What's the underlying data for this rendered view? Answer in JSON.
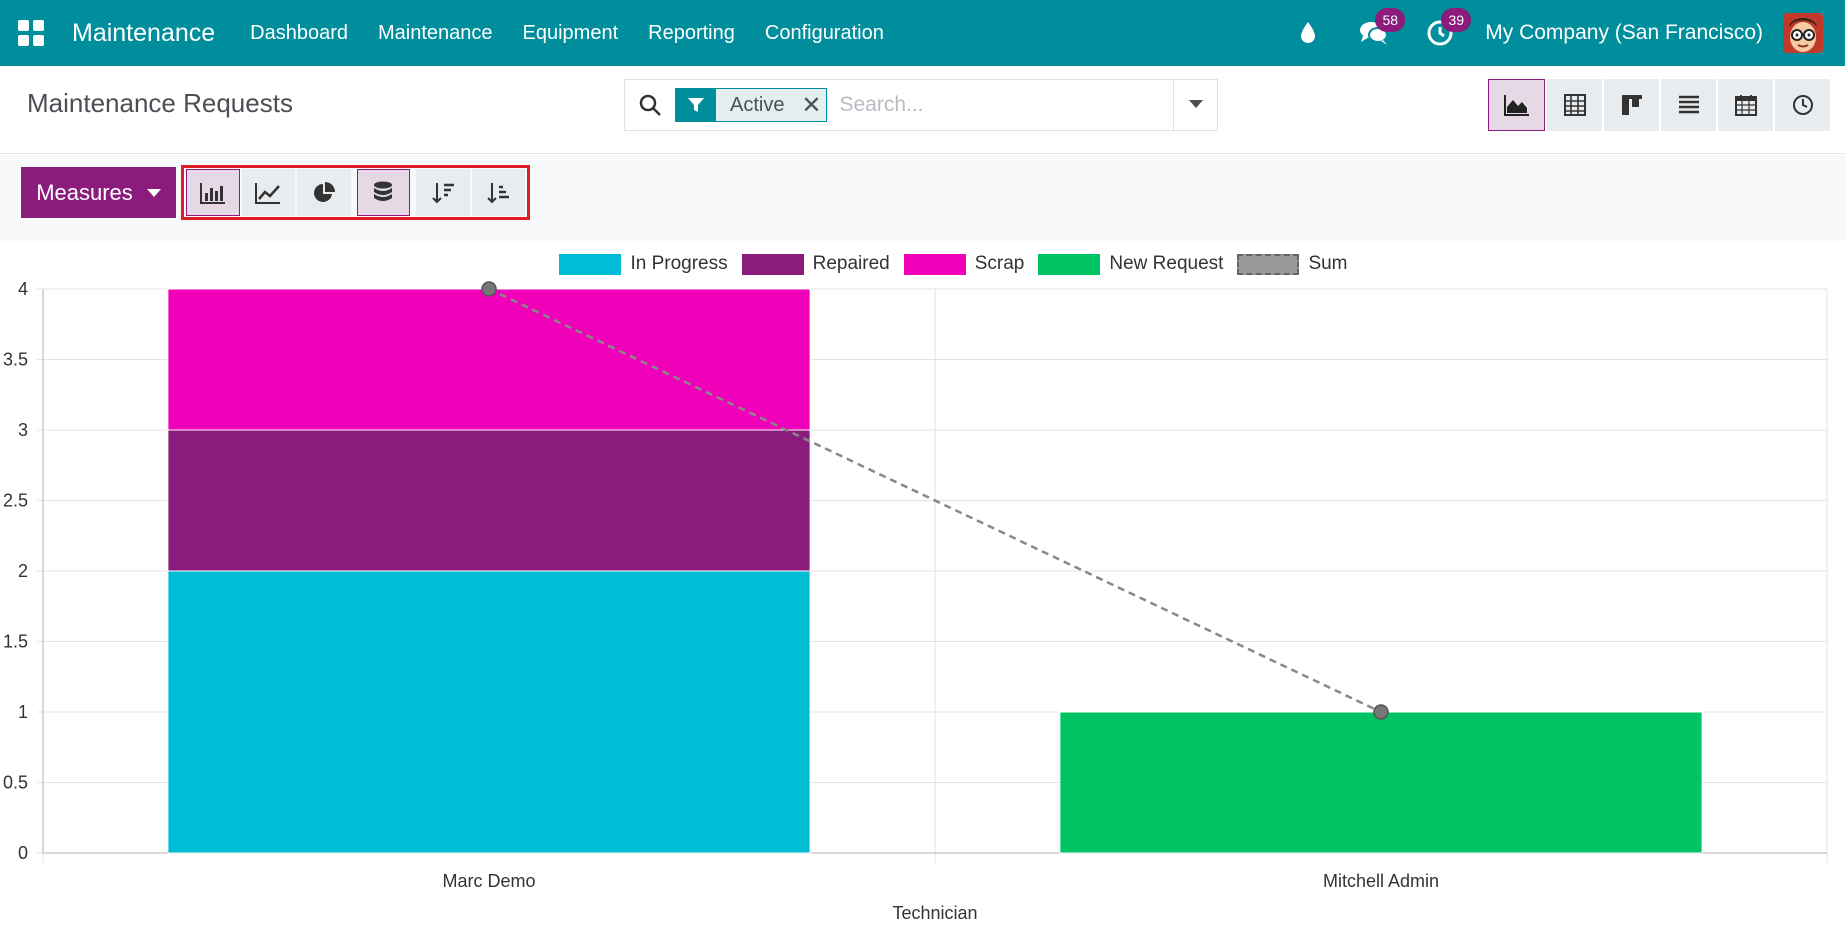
{
  "navbar": {
    "brand": "Maintenance",
    "menu": [
      "Dashboard",
      "Maintenance",
      "Equipment",
      "Reporting",
      "Configuration"
    ],
    "messages_count": "58",
    "activities_count": "39",
    "company": "My Company (San Francisco)",
    "bg_color": "#018e9c"
  },
  "control_panel": {
    "title": "Maintenance Requests",
    "search": {
      "facet_value": "Active",
      "placeholder": "Search..."
    },
    "views": [
      "graph-icon",
      "pivot-icon",
      "kanban-icon",
      "list-icon",
      "calendar-icon",
      "activity-icon"
    ],
    "active_view": "graph"
  },
  "toolbar": {
    "measures_label": "Measures",
    "modes": [
      "bar-chart-icon",
      "line-chart-icon",
      "pie-chart-icon",
      "stacked-icon",
      "sort-descending-icon",
      "sort-ascending-icon"
    ],
    "active_mode": "bar",
    "stacked": true,
    "accent_color": "#8b1b7d"
  },
  "chart_data": {
    "type": "bar",
    "stacked": true,
    "categories": [
      "Marc Demo",
      "Mitchell Admin"
    ],
    "series": [
      {
        "name": "In Progress",
        "values": [
          2,
          0
        ],
        "color": "#00bcd4"
      },
      {
        "name": "Repaired",
        "values": [
          1,
          0
        ],
        "color": "#8b1b7d"
      },
      {
        "name": "Scrap",
        "values": [
          1,
          0
        ],
        "color": "#f000b8"
      },
      {
        "name": "New Request",
        "values": [
          0,
          1
        ],
        "color": "#00c364"
      }
    ],
    "line_series": {
      "name": "Sum",
      "values": [
        4,
        1
      ],
      "color": "#888888",
      "style": "dashed"
    },
    "xlabel": "Technician",
    "ylabel": "",
    "ylim": [
      0,
      4
    ],
    "yticks": [
      "0",
      "0.5",
      "1",
      "1.5",
      "2",
      "2.5",
      "3",
      "3.5",
      "4"
    ],
    "grid": true,
    "legend_position": "top-center"
  }
}
